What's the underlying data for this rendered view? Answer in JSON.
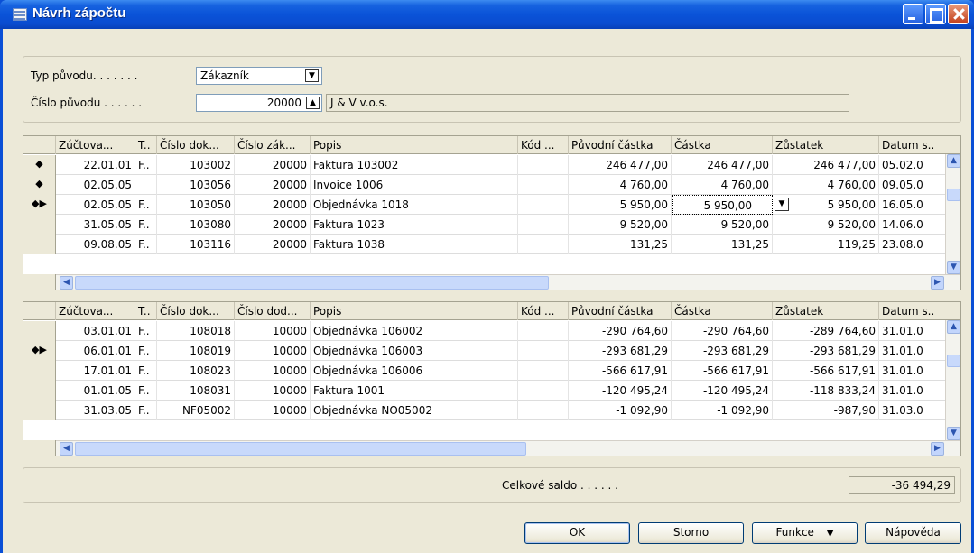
{
  "window": {
    "title": "Návrh zápočtu"
  },
  "origin": {
    "type_label": "Typ původu. . . . . . .",
    "type_value": "Zákazník",
    "number_label": "Číslo původu . . . . . .",
    "number_value": "20000",
    "name_value": "J & V v.o.s."
  },
  "grid1": {
    "headers": [
      "Zúčtova...",
      "T..",
      "Číslo dok...",
      "Číslo zák...",
      "Popis",
      "Kód ...",
      "Původní částka",
      "Částka",
      "Zůstatek",
      "Datum s.."
    ],
    "rows": [
      {
        "mark": "◆",
        "cells": [
          "22.01.01",
          "F..",
          "103002",
          "20000",
          "Faktura 103002",
          "",
          "246 477,00",
          "246 477,00",
          "246 477,00",
          "05.02.0"
        ]
      },
      {
        "mark": "◆",
        "cells": [
          "02.05.05",
          "",
          "103056",
          "20000",
          "Invoice 1006",
          "",
          "4 760,00",
          "4 760,00",
          "4 760,00",
          "09.05.0"
        ]
      },
      {
        "mark": "◆▶",
        "cells": [
          "02.05.05",
          "F..",
          "103050",
          "20000",
          "Objednávka 1018",
          "",
          "5 950,00",
          "5 950,00",
          "5 950,00",
          "16.05.0"
        ]
      },
      {
        "mark": "",
        "cells": [
          "31.05.05",
          "F..",
          "103080",
          "20000",
          "Faktura 1023",
          "",
          "9 520,00",
          "9 520,00",
          "9 520,00",
          "14.06.0"
        ]
      },
      {
        "mark": "",
        "cells": [
          "09.08.05",
          "F..",
          "103116",
          "20000",
          "Faktura 1038",
          "",
          "131,25",
          "131,25",
          "119,25",
          "23.08.0"
        ]
      }
    ]
  },
  "grid2": {
    "headers": [
      "Zúčtova...",
      "T..",
      "Číslo dok...",
      "Číslo dod...",
      "Popis",
      "Kód ...",
      "Původní částka",
      "Částka",
      "Zůstatek",
      "Datum s.."
    ],
    "rows": [
      {
        "mark": "",
        "cells": [
          "03.01.01",
          "F..",
          "108018",
          "10000",
          "Objednávka 106002",
          "",
          "-290 764,60",
          "-290 764,60",
          "-289 764,60",
          "31.01.0"
        ]
      },
      {
        "mark": "◆▶",
        "cells": [
          "06.01.01",
          "F..",
          "108019",
          "10000",
          "Objednávka 106003",
          "",
          "-293 681,29",
          "-293 681,29",
          "-293 681,29",
          "31.01.0"
        ]
      },
      {
        "mark": "",
        "cells": [
          "17.01.01",
          "F..",
          "108023",
          "10000",
          "Objednávka 106006",
          "",
          "-566 617,91",
          "-566 617,91",
          "-566 617,91",
          "31.01.0"
        ]
      },
      {
        "mark": "",
        "cells": [
          "01.01.05",
          "F..",
          "108031",
          "10000",
          "Faktura 1001",
          "",
          "-120 495,24",
          "-120 495,24",
          "-118 833,24",
          "31.01.0"
        ]
      },
      {
        "mark": "",
        "cells": [
          "31.03.05",
          "F..",
          "NF05002",
          "10000",
          "Objednávka NO05002",
          "",
          "-1 092,90",
          "-1 092,90",
          "-987,90",
          "31.03.0"
        ]
      }
    ]
  },
  "total": {
    "label": "Celkové saldo . . . . . .",
    "value": "-36 494,29"
  },
  "buttons": {
    "ok": "OK",
    "cancel": "Storno",
    "functions": "Funkce",
    "help": "Nápověda"
  }
}
